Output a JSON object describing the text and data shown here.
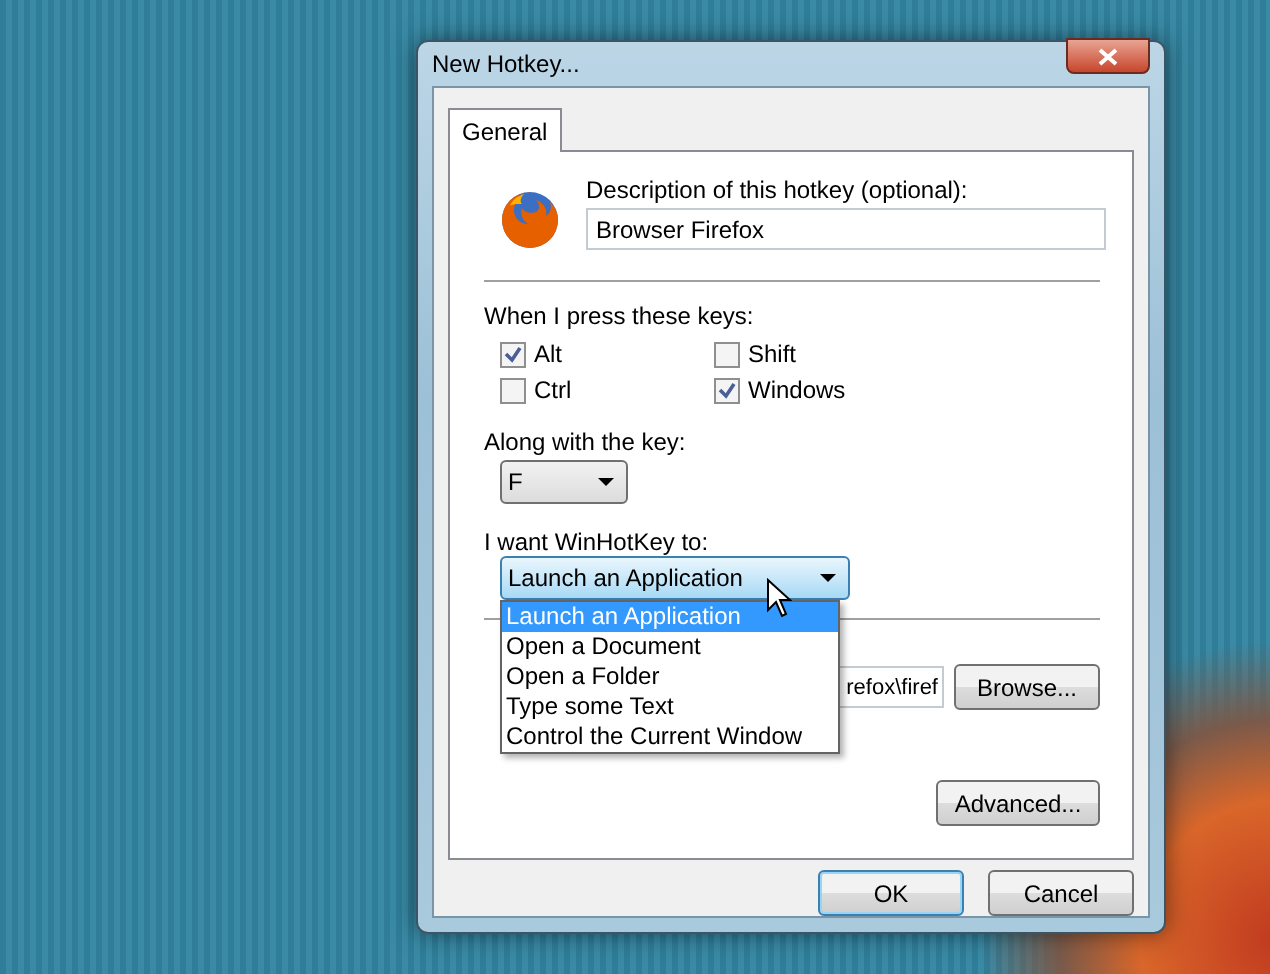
{
  "window": {
    "title": "New Hotkey..."
  },
  "tabs": [
    {
      "label": "General",
      "selected": true
    }
  ],
  "description": {
    "label": "Description of this hotkey (optional):",
    "value": "Browser Firefox"
  },
  "keys": {
    "label": "When I press these keys:",
    "modifiers": [
      {
        "label": "Alt",
        "checked": true
      },
      {
        "label": "Shift",
        "checked": false
      },
      {
        "label": "Ctrl",
        "checked": false
      },
      {
        "label": "Windows",
        "checked": true
      }
    ]
  },
  "key": {
    "label": "Along with the key:",
    "value": "F"
  },
  "action": {
    "label": "I want WinHotKey to:",
    "value": "Launch an Application",
    "expanded": true,
    "options": [
      {
        "label": "Launch an Application",
        "selected": true
      },
      {
        "label": "Open a Document",
        "selected": false
      },
      {
        "label": "Open a Folder",
        "selected": false
      },
      {
        "label": "Type some Text",
        "selected": false
      },
      {
        "label": "Control the Current Window",
        "selected": false
      }
    ]
  },
  "path": {
    "value": "refox\\firef"
  },
  "buttons": {
    "browse": "Browse...",
    "advanced": "Advanced...",
    "ok": "OK",
    "cancel": "Cancel"
  }
}
